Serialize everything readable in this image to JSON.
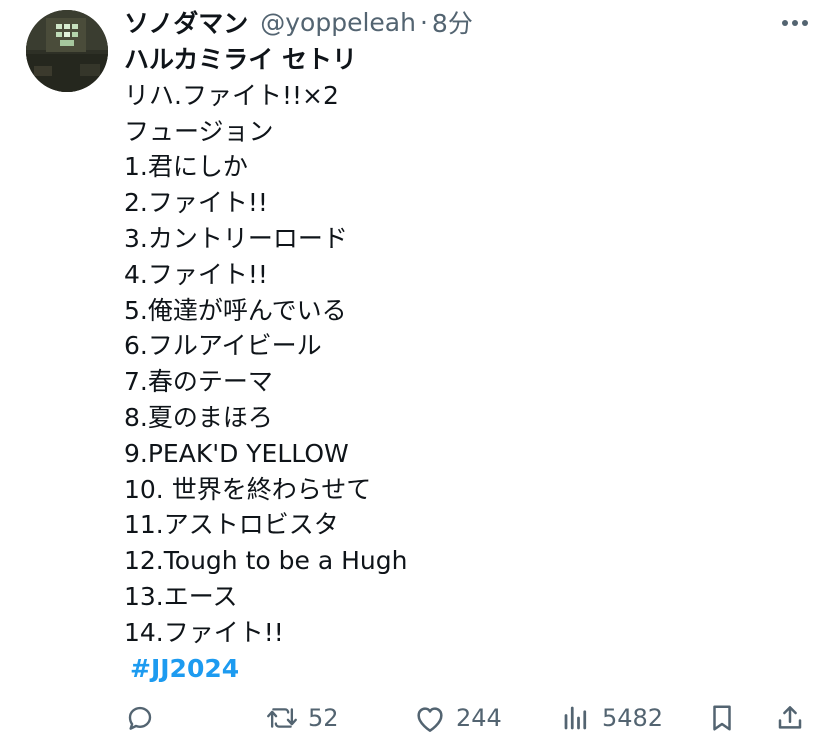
{
  "author": {
    "display_name": "ソノダマン",
    "handle": "@yoppeleah",
    "separator": "·",
    "time": "8分"
  },
  "tweet": {
    "lines": [
      "ハルカミライ セトリ",
      "リハ.ファイト!!×2",
      "フュージョン",
      "1.君にしか",
      "2.ファイト!!",
      "3.カントリーロード",
      "4.ファイト!!",
      "5.俺達が呼んでいる",
      "6.フルアイビール",
      "7.春のテーマ",
      "8.夏のまほろ",
      "9.PEAK'D YELLOW",
      "10. 世界を終わらせて",
      "11.アストロビスタ",
      "12.Tough to be a Hugh",
      "13.エース",
      "14.ファイト!!"
    ],
    "hashtag": "#JJ2024"
  },
  "actions": {
    "reply": {
      "icon": "reply-icon",
      "count": ""
    },
    "retweet": {
      "icon": "retweet-icon",
      "count": "52"
    },
    "like": {
      "icon": "heart-icon",
      "count": "244"
    },
    "views": {
      "icon": "views-icon",
      "count": "5482"
    },
    "bookmark": {
      "icon": "bookmark-icon"
    },
    "share": {
      "icon": "share-icon"
    }
  },
  "colors": {
    "text": "#0f1419",
    "secondary": "#536471",
    "link": "#1d9bf0"
  }
}
